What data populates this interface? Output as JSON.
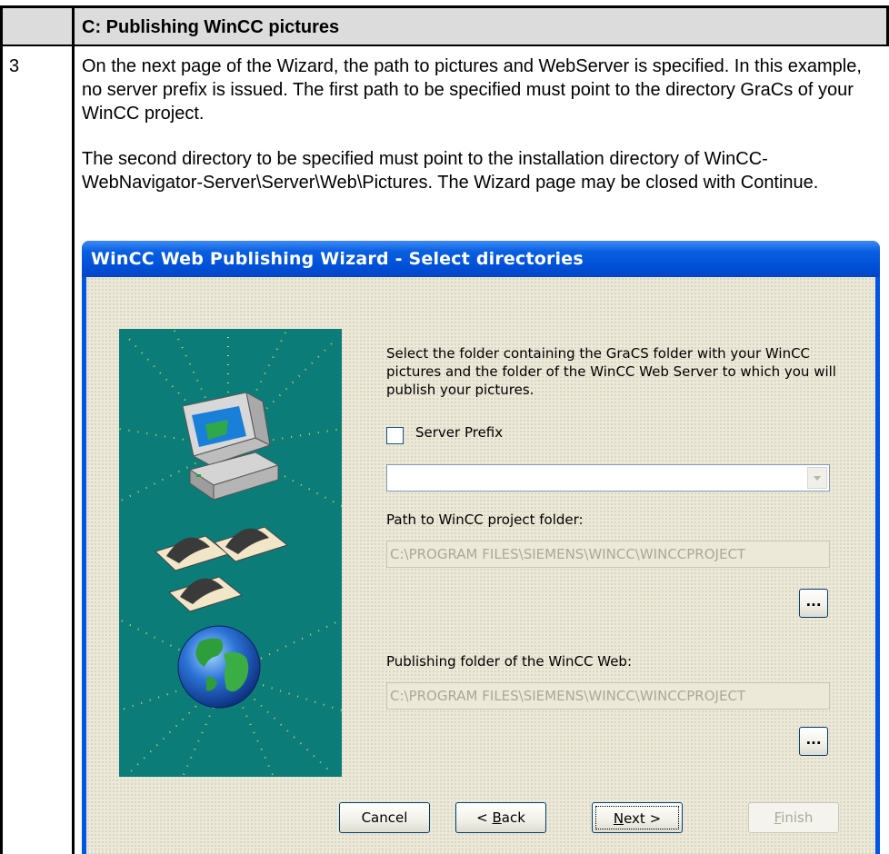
{
  "table": {
    "header_title": "C: Publishing WinCC pictures",
    "step_number": "3",
    "paragraph1": "On the next page of the Wizard, the path to pictures and WebServer is specified. In this example, no server prefix is issued. The first path to be specified must point to the directory GraCs of your WinCC project.",
    "paragraph2": "The second directory to be specified must point to the installation directory of WinCC-WebNavigator-Server\\Server\\Web\\Pictures. The Wizard page may be closed with Continue."
  },
  "dialog": {
    "title": "WinCC Web Publishing Wizard - Select directories",
    "instructions": "Select the folder containing the GraCS folder with your WinCC pictures  and  the folder of the WinCC Web Server to which you will publish your pictures.",
    "server_prefix_label": "Server Prefix",
    "server_prefix_checked": false,
    "server_prefix_value": "",
    "project_folder_label": "Path to WinCC project folder:",
    "project_folder_value": "C:\\PROGRAM FILES\\SIEMENS\\WINCC\\WINCCPROJECT",
    "publishing_folder_label": "Publishing folder of the WinCC Web:",
    "publishing_folder_value": "C:\\PROGRAM FILES\\SIEMENS\\WINCC\\WINCCPROJECT",
    "browse_label": "...",
    "buttons": {
      "cancel": "Cancel",
      "back_prefix": "< ",
      "back_mnemonic": "B",
      "back_rest": "ack",
      "next_mnemonic": "N",
      "next_rest": "ext >",
      "finish_mnemonic": "F",
      "finish_rest": "inish"
    }
  },
  "colors": {
    "title_bar": "#0055e5",
    "dialog_face": "#ece9d8",
    "art_background": "#0c7c78",
    "table_header": "#dcdcdc"
  },
  "icons": [
    "computer-icon",
    "documents-icon",
    "globe-icon",
    "dropdown-arrow-icon"
  ]
}
